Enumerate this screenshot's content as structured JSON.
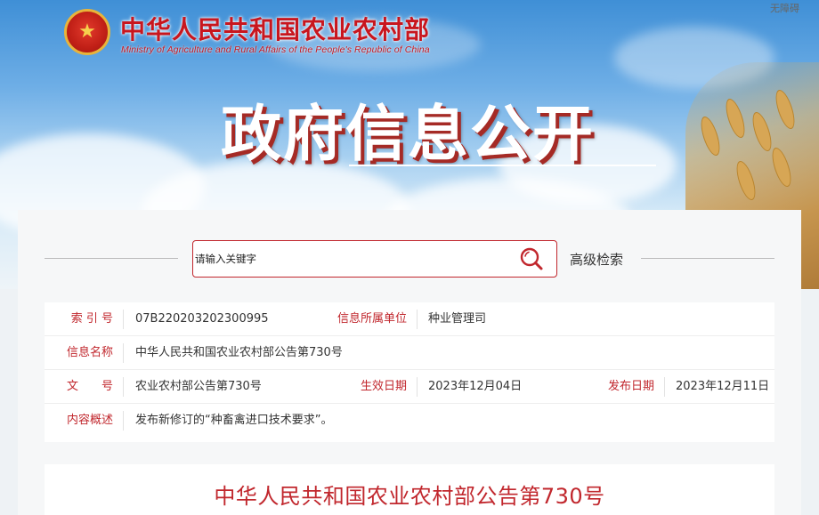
{
  "header": {
    "ministry_cn": "中华人民共和国农业农村部",
    "ministry_en": "Ministry of Agriculture and Rural Affairs of the People's Republic of China",
    "accessibility": "无障碍",
    "banner_title": "政府信息公开",
    "emblem_icon": "national-emblem"
  },
  "search": {
    "placeholder": "请输入关键字",
    "value": "",
    "advanced_label": "高级检索",
    "icon": "search-icon"
  },
  "info": {
    "index_label": "索 引 号",
    "index_value": "07B220203202300995",
    "unit_label": "信息所属单位",
    "unit_value": "种业管理司",
    "name_label": "信息名称",
    "name_value": "中华人民共和国农业农村部公告第730号",
    "doc_label": "文　　号",
    "doc_value": "农业农村部公告第730号",
    "effective_label": "生效日期",
    "effective_value": "2023年12月04日",
    "publish_label": "发布日期",
    "publish_value": "2023年12月11日",
    "summary_label": "内容概述",
    "summary_value": "发布新修订的“种畜禽进口技术要求”。"
  },
  "content": {
    "title": "中华人民共和国农业农村部公告第730号"
  },
  "colors": {
    "brand_red": "#c1272d",
    "banner_blue": "#3f8fd6",
    "text": "#333333"
  }
}
